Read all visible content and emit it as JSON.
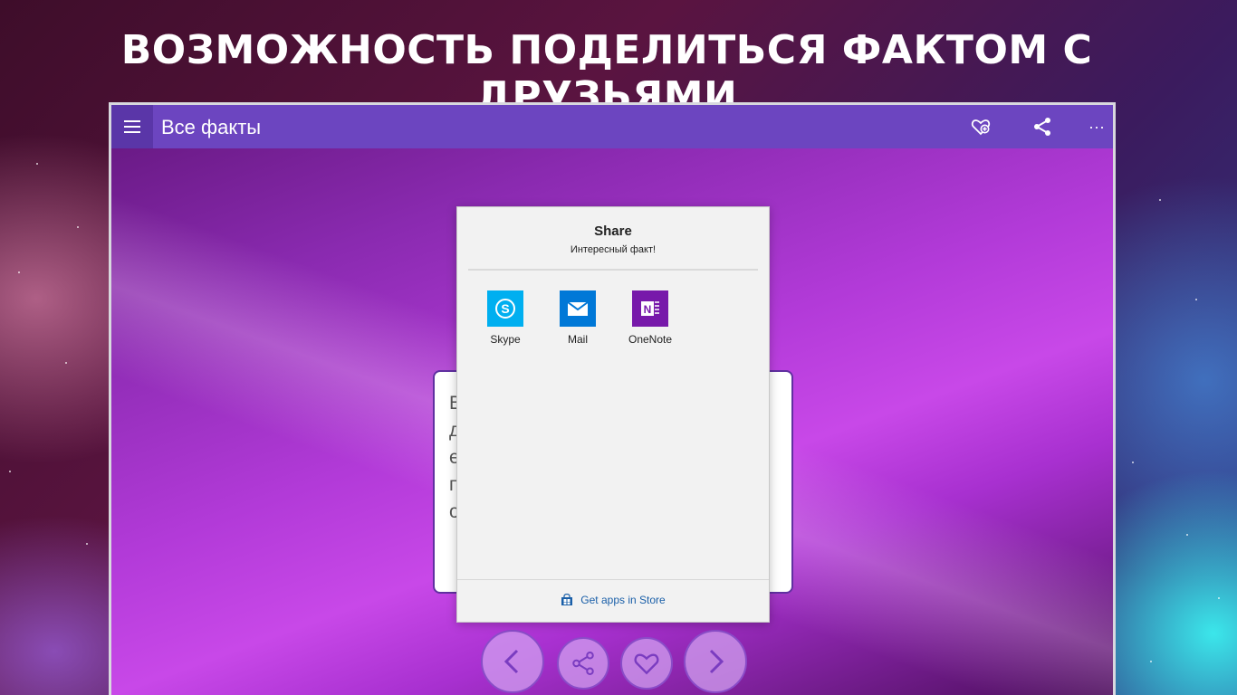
{
  "headline": "ВОЗМОЖНОСТЬ ПОДЕЛИТЬСЯ ФАКТОМ С ДРУЗЬЯМИ",
  "window": {
    "title": "Все факты",
    "toolbar": {
      "menu_icon": "hamburger-icon",
      "favorite_icon": "heart-add-icon",
      "share_icon": "share-icon",
      "more_label": "···"
    }
  },
  "fact_card": {
    "visible_letters": [
      "В",
      "д",
      "е",
      "п",
      "о"
    ]
  },
  "share_panel": {
    "title": "Share",
    "subtitle": "Интересный факт!",
    "apps": [
      {
        "label": "Skype",
        "icon": "skype-icon",
        "color": "#00aff0"
      },
      {
        "label": "Mail",
        "icon": "mail-icon",
        "color": "#0078d7"
      },
      {
        "label": "OneNote",
        "icon": "onenote-icon",
        "color": "#7719aa"
      }
    ],
    "store_link": "Get apps in Store",
    "store_icon": "store-icon"
  },
  "nav_buttons": [
    {
      "icon": "chevron-left-icon"
    },
    {
      "icon": "share-icon"
    },
    {
      "icon": "heart-icon"
    },
    {
      "icon": "chevron-right-icon"
    }
  ],
  "colors": {
    "titlebar": "#6c45c0",
    "accent": "#8a4cc8",
    "link": "#1a5fa8"
  }
}
